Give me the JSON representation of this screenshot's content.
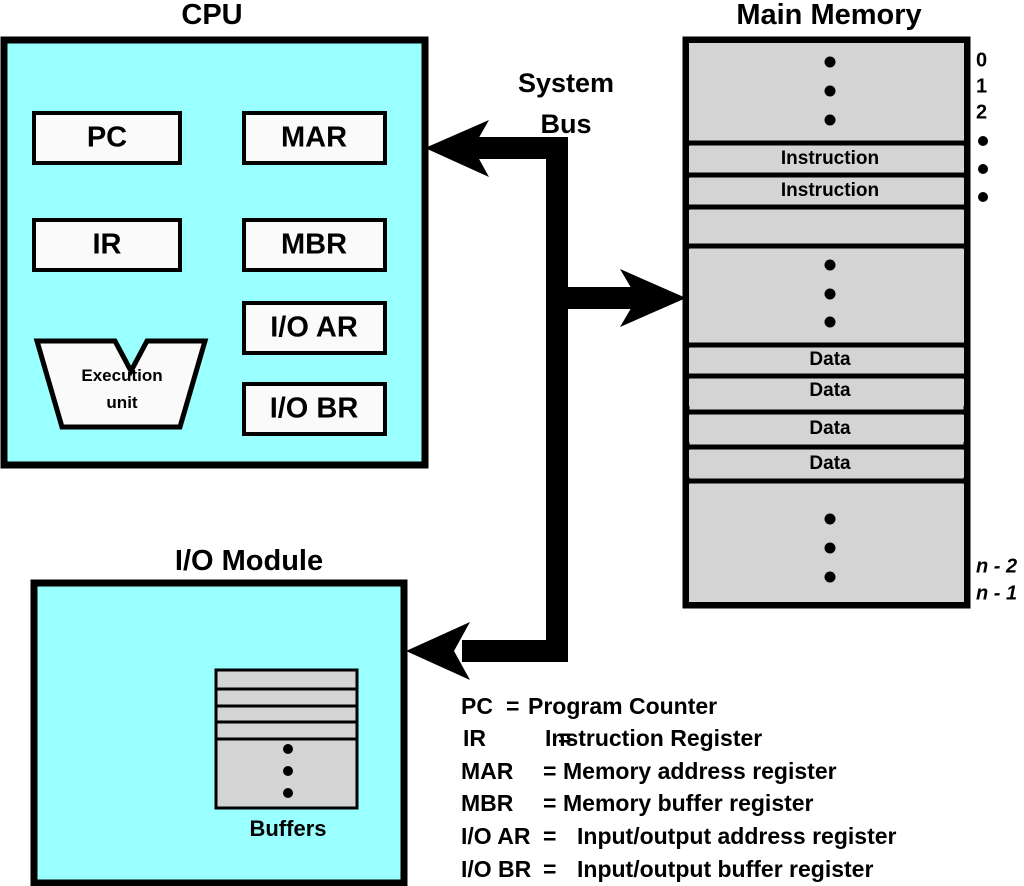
{
  "diagram": {
    "titles": {
      "cpu": "CPU",
      "main_memory": "Main Memory",
      "io_module": "I/O Module",
      "system_bus_line1": "System",
      "system_bus_line2": "Bus"
    },
    "colors": {
      "block_fill": "#99FFFF",
      "memory_fill": "#D4D4D4",
      "register_fill": "#FAFAFA",
      "stroke": "#000000",
      "background": "#FFFFFF"
    }
  },
  "cpu": {
    "registers_left": [
      {
        "label": "PC"
      },
      {
        "label": "IR"
      }
    ],
    "registers_right": [
      {
        "label": "MAR"
      },
      {
        "label": "MBR"
      },
      {
        "label": "I/O AR"
      },
      {
        "label": "I/O BR"
      }
    ],
    "execution_unit": {
      "line1": "Execution",
      "line2": "unit"
    }
  },
  "memory": {
    "cells": [
      {
        "kind": "ellipsis",
        "label": ""
      },
      {
        "kind": "text",
        "label": "Instruction"
      },
      {
        "kind": "text",
        "label": "Instruction"
      },
      {
        "kind": "blank",
        "label": ""
      },
      {
        "kind": "ellipsis",
        "label": ""
      },
      {
        "kind": "text",
        "label": "Data"
      },
      {
        "kind": "text",
        "label": "Data"
      },
      {
        "kind": "text",
        "label": "Data"
      },
      {
        "kind": "text",
        "label": "Data"
      },
      {
        "kind": "ellipsis",
        "label": ""
      }
    ],
    "addresses_top": [
      "0",
      "1",
      "2"
    ],
    "addresses_top_ellipsis_count": 3,
    "addresses_bottom": [
      "n - 2",
      "n - 1"
    ]
  },
  "io_module": {
    "buffers_label": "Buffers",
    "buffer_rows": 4,
    "buffer_ellipsis_count": 3
  },
  "legend": [
    {
      "abbr": "PC",
      "eq": "=",
      "desc": "Program Counter"
    },
    {
      "abbr": "IR",
      "eq": "=",
      "desc": "Instruction Register"
    },
    {
      "abbr": "MAR",
      "eq": "=",
      "desc": "Memory address register"
    },
    {
      "abbr": "MBR",
      "eq": "=",
      "desc": "Memory buffer register"
    },
    {
      "abbr": "I/O AR",
      "eq": "=",
      "desc": "Input/output address register"
    },
    {
      "abbr": "I/O BR",
      "eq": "=",
      "desc": "Input/output buffer register"
    }
  ]
}
